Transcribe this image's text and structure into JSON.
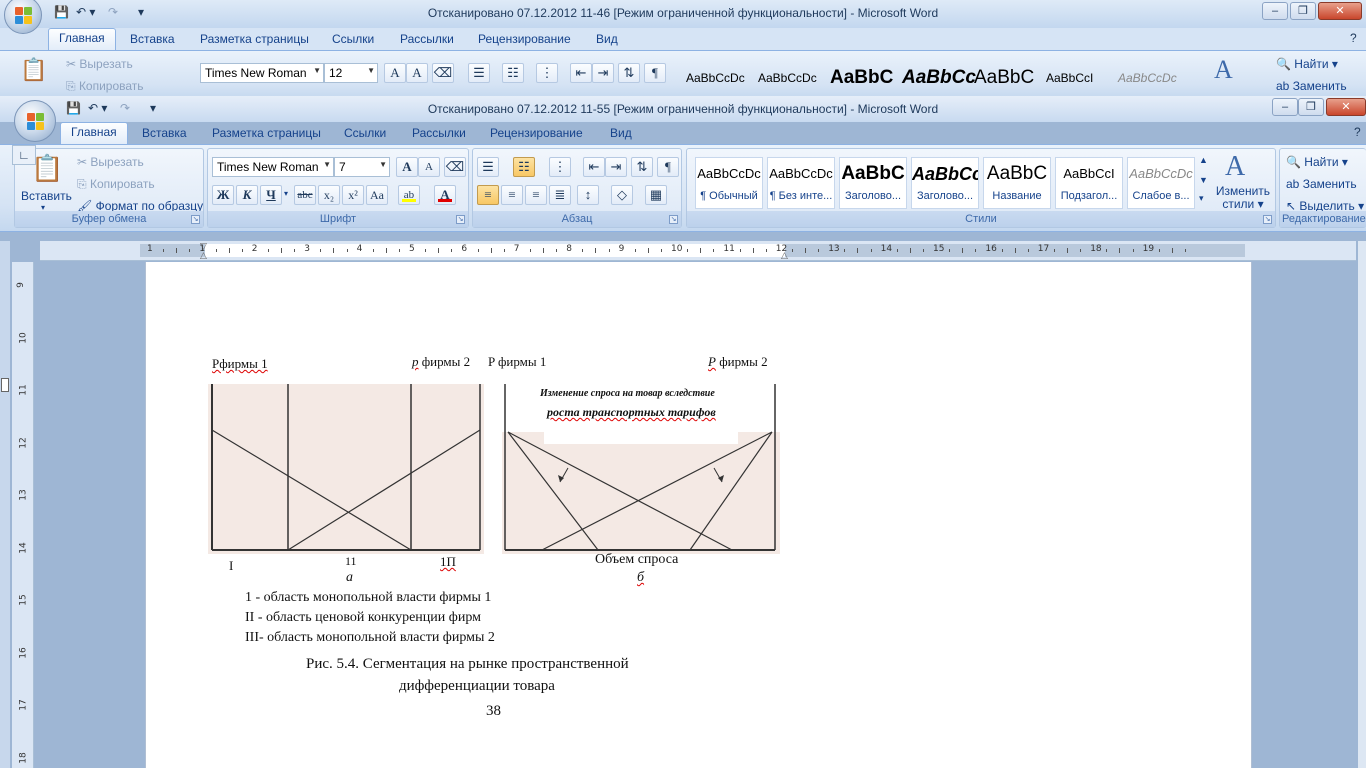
{
  "back_window": {
    "title": "Отсканировано 07.12.2012 11-46 [Режим ограниченной функциональности] - Microsoft Word",
    "tabs": [
      "Главная",
      "Вставка",
      "Разметка страницы",
      "Ссылки",
      "Рассылки",
      "Рецензирование",
      "Вид"
    ],
    "clipboard": {
      "cut": "Вырезать",
      "copy": "Копировать"
    },
    "font_name": "Times New Roman",
    "font_size": "12",
    "styles": [
      "AaBbCcDc",
      "AaBbCcDc",
      "AaBbC",
      "AaBbCc",
      "AaBbC",
      "AaBbCcI",
      "AaBbCcDc"
    ],
    "editing": {
      "find": "Найти",
      "replace": "Заменить"
    }
  },
  "window": {
    "title": "Отсканировано 07.12.2012 11-55 [Режим ограниченной функциональности] - Microsoft Word",
    "tabs": [
      "Главная",
      "Вставка",
      "Разметка страницы",
      "Ссылки",
      "Рассылки",
      "Рецензирование",
      "Вид"
    ],
    "active_tab": "Главная"
  },
  "ribbon": {
    "clipboard": {
      "label": "Буфер обмена",
      "paste": "Вставить",
      "cut": "Вырезать",
      "copy": "Копировать",
      "format_painter": "Формат по образцу"
    },
    "font": {
      "label": "Шрифт",
      "name": "Times New Roman",
      "size": "7",
      "bold": "Ж",
      "italic": "К",
      "underline": "Ч",
      "strike": "abc",
      "subscript": "x₂",
      "superscript": "x²",
      "case": "Aa",
      "grow": "A",
      "shrink": "A",
      "font_color": "A",
      "highlight": "ab",
      "colors": {
        "highlight": "#ffff00",
        "font_color": "#e00000"
      }
    },
    "paragraph": {
      "label": "Абзац"
    },
    "styles": {
      "label": "Стили",
      "items": [
        {
          "sample": "AaBbCcDc",
          "name": "¶ Обычный"
        },
        {
          "sample": "AaBbCcDc",
          "name": "¶ Без инте..."
        },
        {
          "sample": "AaBbC",
          "name": "Заголово..."
        },
        {
          "sample": "AaBbCc",
          "name": "Заголово..."
        },
        {
          "sample": "AaBbC",
          "name": "Название"
        },
        {
          "sample": "AaBbCcI",
          "name": "Подзагол..."
        },
        {
          "sample": "AaBbCcDc",
          "name": "Слабое в..."
        }
      ],
      "change_styles": "Изменить стили"
    },
    "editing": {
      "label": "Редактирование",
      "find": "Найти",
      "replace": "Заменить",
      "select": "Выделить"
    }
  },
  "ruler": {
    "numbers": [
      "1",
      "1",
      "2",
      "3",
      "4",
      "5",
      "6",
      "7",
      "8",
      "9",
      "10",
      "11",
      "12",
      "13",
      "14",
      "15",
      "16",
      "17",
      "18",
      "19"
    ],
    "vertical_numbers": [
      "9",
      "10",
      "11",
      "12",
      "13",
      "14",
      "15",
      "16",
      "17",
      "18"
    ]
  },
  "document": {
    "fig_a_top_left": "Рфирмы 1",
    "fig_a_top_right_p": "p",
    "fig_a_top_right": "фирмы  2",
    "fig_b_top_left": "P фирмы 1",
    "fig_b_top_right_p": "P",
    "fig_b_top_right": "фирмы 2",
    "fig_b_caption_line1": "Изменение  спроса  на  товар  вследствие",
    "fig_b_caption_line2": "роста транспортных тарифов",
    "fig_a_bottom_1": "I",
    "fig_a_bottom_2": "11",
    "fig_a_bottom_3": "1П",
    "fig_b_bottom": "Объем спроса",
    "label_a": "а",
    "label_b": "б",
    "legend_1": "1 - область монопольной власти фирмы 1",
    "legend_2": "II - область ценовой конкуренции фирм",
    "legend_3": "III-  область монопольной власти фирмы 2",
    "caption_line1": "Рис. 5.4. Сегментация на рынке пространственной",
    "caption_line2": "дифференциации товара",
    "page_number": "38"
  }
}
